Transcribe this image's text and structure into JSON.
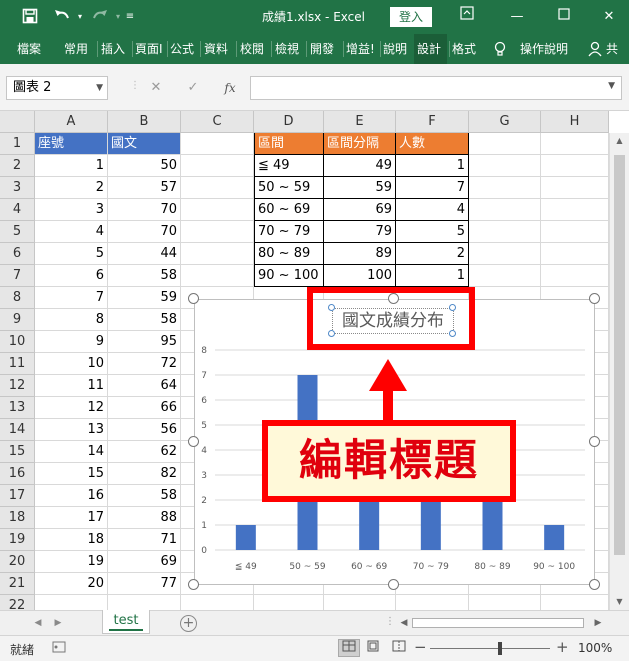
{
  "titlebar": {
    "save_icon": "save-icon",
    "undo_icon": "undo-icon",
    "redo_icon": "redo-icon",
    "customize_icon": "customize-quick-access-icon",
    "title": "成績1.xlsx  -  Excel",
    "login_label": "登入",
    "ribbon_display_icon": "ribbon-display-icon",
    "minimize_icon": "minimize-icon",
    "restore_icon": "restore-icon",
    "close_icon": "close-icon"
  },
  "ribbon": {
    "tabs": [
      "檔案",
      "常用",
      "插入",
      "頁面I",
      "公式",
      "資料",
      "校閱",
      "檢視",
      "開發",
      "增益!",
      "說明",
      "設計",
      "格式"
    ],
    "active_tab": "設計",
    "tellme_icon": "lightbulb-icon",
    "tellme_label": "操作說明",
    "share_icon": "share-person-icon",
    "share_label": "共"
  },
  "formula_bar": {
    "name_box": "圖表 2",
    "cancel_glyph": "✕",
    "enter_glyph": "✓",
    "fx_glyph": "fx",
    "formula": ""
  },
  "sheet": {
    "columns": [
      "A",
      "B",
      "C",
      "D",
      "E",
      "F",
      "G",
      "H"
    ],
    "rows": [
      "1",
      "2",
      "3",
      "4",
      "5",
      "6",
      "7",
      "8",
      "9",
      "10",
      "11",
      "12",
      "13",
      "14",
      "15",
      "16",
      "17",
      "18",
      "19",
      "20",
      "21",
      "22"
    ],
    "headers_ab": [
      "座號",
      "國文"
    ],
    "scores": [
      [
        "1",
        "50"
      ],
      [
        "2",
        "57"
      ],
      [
        "3",
        "70"
      ],
      [
        "4",
        "70"
      ],
      [
        "5",
        "44"
      ],
      [
        "6",
        "58"
      ],
      [
        "7",
        "59"
      ],
      [
        "8",
        "58"
      ],
      [
        "9",
        "95"
      ],
      [
        "10",
        "72"
      ],
      [
        "11",
        "64"
      ],
      [
        "12",
        "66"
      ],
      [
        "13",
        "56"
      ],
      [
        "14",
        "62"
      ],
      [
        "15",
        "82"
      ],
      [
        "16",
        "58"
      ],
      [
        "17",
        "88"
      ],
      [
        "18",
        "71"
      ],
      [
        "19",
        "69"
      ],
      [
        "20",
        "77"
      ]
    ],
    "headers_def": [
      "區間",
      "區間分隔",
      "人數"
    ],
    "bins": [
      [
        "≦ 49",
        "49",
        "1"
      ],
      [
        "50 ~ 59",
        "59",
        "7"
      ],
      [
        "60 ~ 69",
        "69",
        "4"
      ],
      [
        "70 ~ 79",
        "79",
        "5"
      ],
      [
        "80 ~ 89",
        "89",
        "2"
      ],
      [
        "90 ~ 100",
        "100",
        "1"
      ]
    ],
    "header_blue": "#4472c4",
    "header_orange": "#ed7d31"
  },
  "chart_data": {
    "type": "bar",
    "title": "國文成績分布",
    "categories": [
      "≦ 49",
      "50 ~ 59",
      "60 ~ 69",
      "70 ~ 79",
      "80 ~ 89",
      "90 ~ 100"
    ],
    "values": [
      1,
      7,
      4,
      5,
      2,
      1
    ],
    "ylim": [
      0,
      8
    ],
    "yticks": [
      "0",
      "1",
      "2",
      "3",
      "4",
      "5",
      "6",
      "7",
      "8"
    ],
    "grid": true,
    "bar_color": "#4472c4",
    "selected": true
  },
  "annotation": {
    "label": "編輯標題",
    "color": "#ff0000",
    "fill": "#fff9d9"
  },
  "sheet_tabs": {
    "tabs": [
      "test"
    ],
    "active": "test",
    "prev_icon": "scroll-left-icon",
    "next_icon": "scroll-right-icon",
    "add_icon": "add-sheet-icon"
  },
  "statusbar": {
    "status": "就緒",
    "macro_icon": "macro-record-icon",
    "zoom": "100%",
    "zoom_value": 100
  }
}
